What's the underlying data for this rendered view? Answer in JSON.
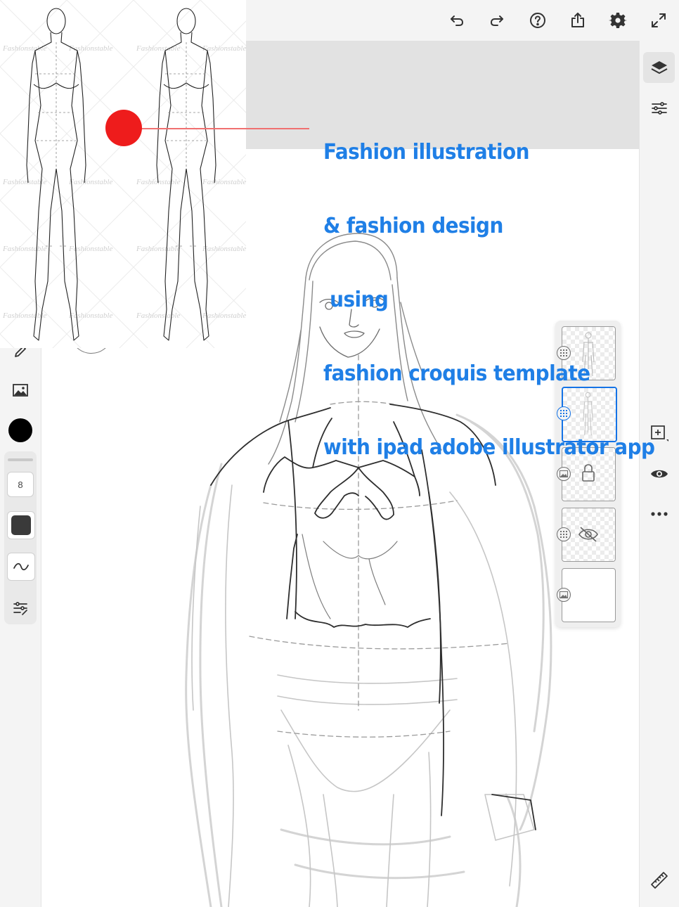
{
  "toolbar": {
    "icons": [
      "undo-icon",
      "redo-icon",
      "help-icon",
      "share-icon",
      "settings-icon",
      "fullscreen-icon"
    ]
  },
  "overlay": {
    "lines": [
      "Fashion illustration",
      "& fashion design",
      " using",
      "fashion croquis template",
      "with ipad adobe illustrator app"
    ],
    "color": "#1f7fe6",
    "marker_color": "#ee1c1c"
  },
  "croquis": {
    "watermark": "Fashionstable"
  },
  "left_toolbar": {
    "brush_size": "8",
    "color_swatch": "#000000",
    "brush_swatch": "#3a3a3a"
  },
  "layers": [
    {
      "type": "raster",
      "state": "normal"
    },
    {
      "type": "raster",
      "state": "selected"
    },
    {
      "type": "image",
      "state": "locked"
    },
    {
      "type": "raster",
      "state": "hidden"
    },
    {
      "type": "image",
      "state": "normal"
    }
  ],
  "right_toolbar": {
    "icons": [
      "layers-icon",
      "adjustments-icon",
      "add-layer-icon",
      "visibility-icon",
      "more-icon",
      "ruler-icon"
    ]
  },
  "colors": {
    "accent": "#1473e6",
    "toolbar_bg": "#f4f4f4"
  }
}
